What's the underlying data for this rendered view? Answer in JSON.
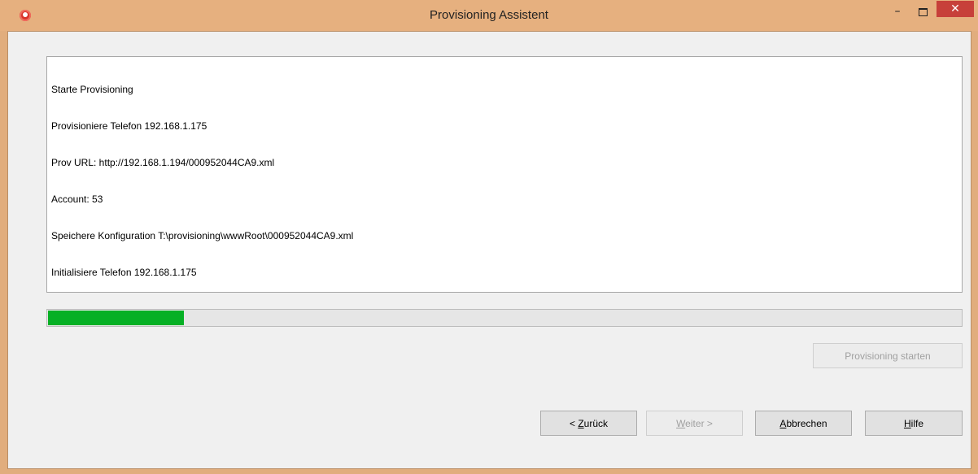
{
  "window": {
    "title": "Provisioning Assistent",
    "minimize_glyph": "–",
    "close_glyph": "✕"
  },
  "log": {
    "lines": [
      "Starte Provisioning",
      "Provisioniere Telefon 192.168.1.175",
      "Prov URL: http://192.168.1.194/000952044CA9.xml",
      "Account: 53",
      "Speichere Konfiguration T:\\provisioning\\wwwRoot\\000952044CA9.xml",
      "Initialisiere Telefon 192.168.1.175"
    ]
  },
  "progress": {
    "value_percent": 15,
    "color": "#06b025"
  },
  "buttons": {
    "start": "Provisioning starten",
    "back": "< Zurück",
    "next": "Weiter >",
    "cancel": "Abbrechen",
    "help": "Hilfe"
  },
  "colors": {
    "frame": "#e1ad7d",
    "close_button": "#c7403a"
  }
}
